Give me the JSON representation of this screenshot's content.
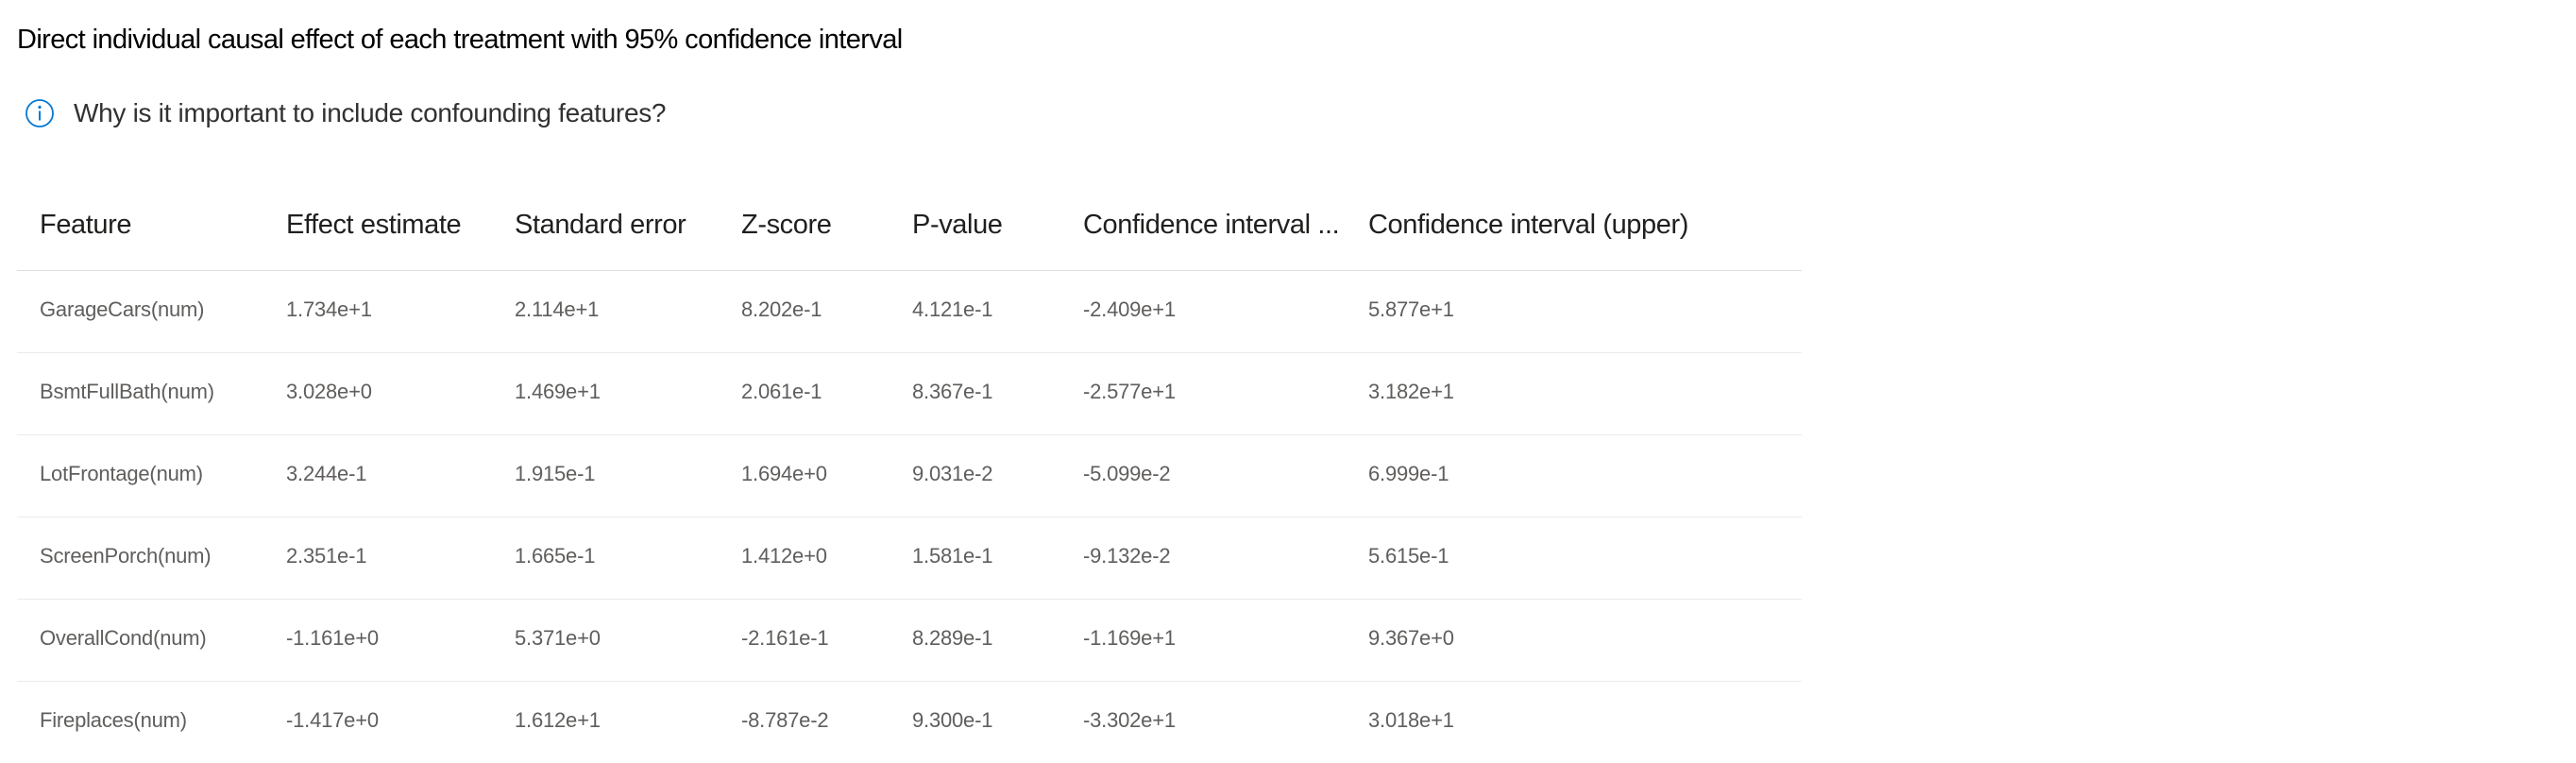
{
  "title": "Direct individual causal effect of each treatment with 95% confidence interval",
  "info_link": {
    "icon": "info-icon",
    "label": "Why is it important to include confounding features?",
    "accent_color": "#0078d4"
  },
  "table": {
    "columns": [
      "Feature",
      "Effect estimate",
      "Standard error",
      "Z-score",
      "P-value",
      "Confidence interval ...",
      "Confidence interval (upper)"
    ],
    "rows": [
      [
        "GarageCars(num)",
        "1.734e+1",
        "2.114e+1",
        "8.202e-1",
        "4.121e-1",
        "-2.409e+1",
        "5.877e+1"
      ],
      [
        "BsmtFullBath(num)",
        "3.028e+0",
        "1.469e+1",
        "2.061e-1",
        "8.367e-1",
        "-2.577e+1",
        "3.182e+1"
      ],
      [
        "LotFrontage(num)",
        "3.244e-1",
        "1.915e-1",
        "1.694e+0",
        "9.031e-2",
        "-5.099e-2",
        "6.999e-1"
      ],
      [
        "ScreenPorch(num)",
        "2.351e-1",
        "1.665e-1",
        "1.412e+0",
        "1.581e-1",
        "-9.132e-2",
        "5.615e-1"
      ],
      [
        "OverallCond(num)",
        "-1.161e+0",
        "5.371e+0",
        "-2.161e-1",
        "8.289e-1",
        "-1.169e+1",
        "9.367e+0"
      ],
      [
        "Fireplaces(num)",
        "-1.417e+0",
        "1.612e+1",
        "-8.787e-2",
        "9.300e-1",
        "-3.302e+1",
        "3.018e+1"
      ]
    ]
  }
}
